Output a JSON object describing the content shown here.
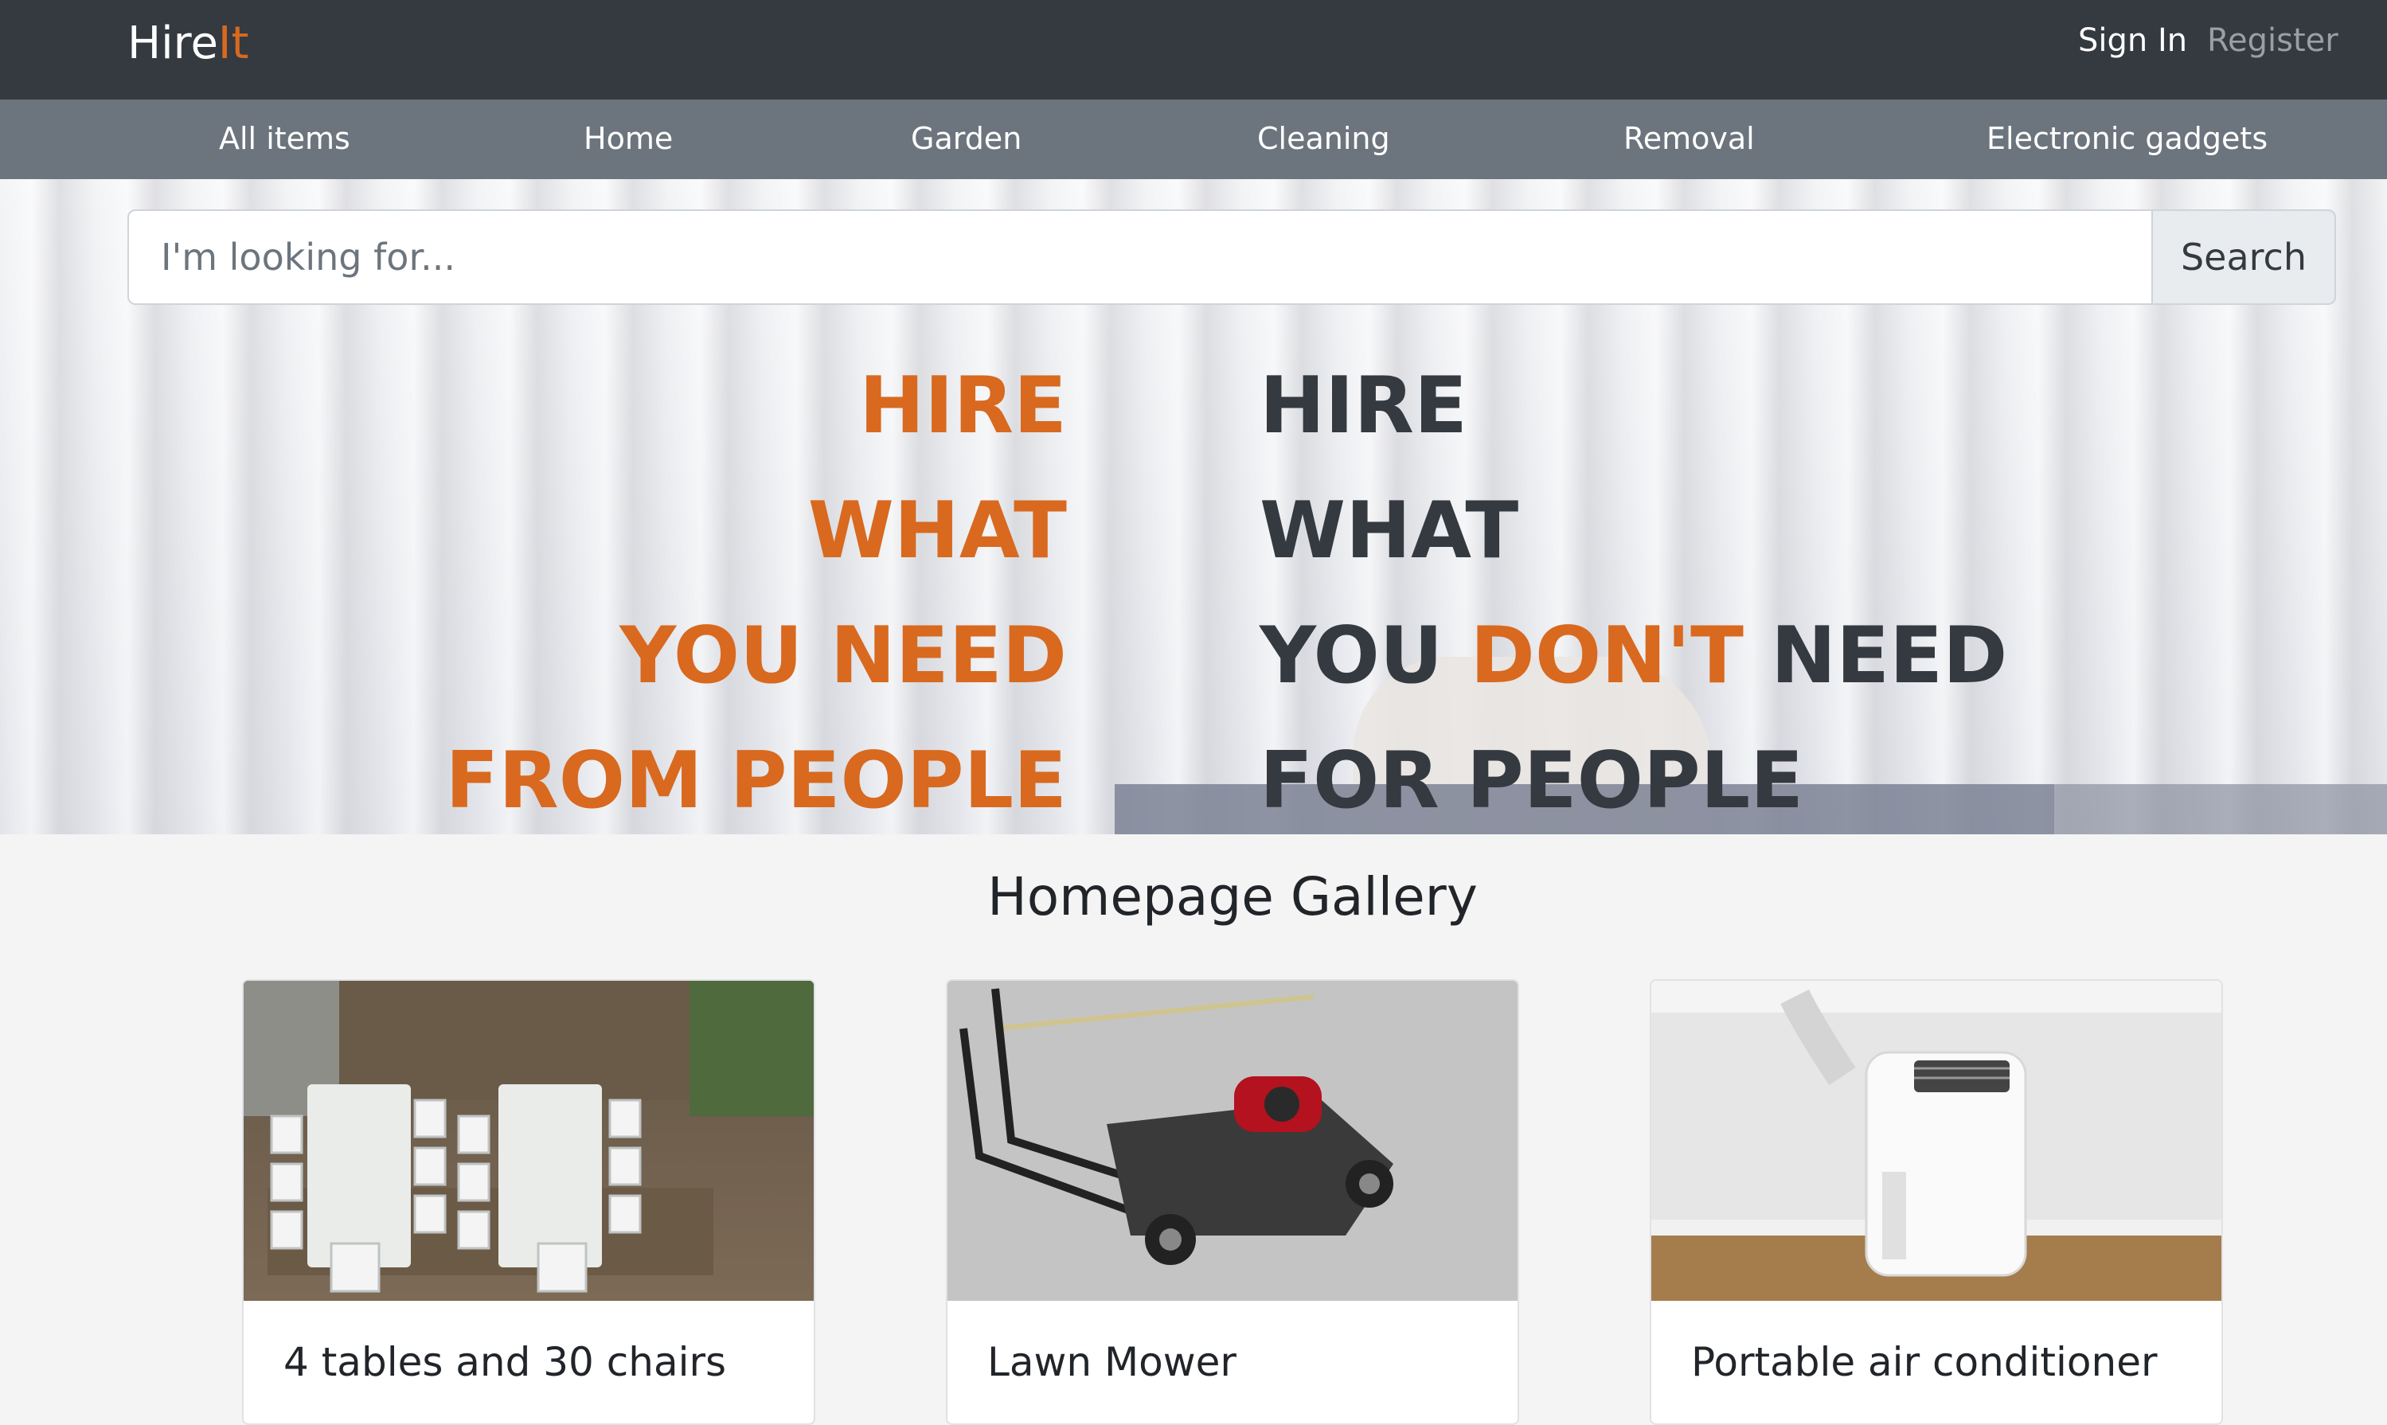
{
  "navbar": {
    "brand_part1": "Hire",
    "brand_part2": "It",
    "sign_in": "Sign In",
    "register": "Register"
  },
  "categories": [
    "All items",
    "Home",
    "Garden",
    "Cleaning",
    "Removal",
    "Electronic gadgets"
  ],
  "search": {
    "placeholder": "I'm looking for...",
    "button": "Search"
  },
  "hero": {
    "left_lines": [
      "HIRE",
      "WHAT",
      "YOU NEED",
      "FROM PEOPLE"
    ],
    "right_lines": {
      "line1": "HIRE",
      "line2": "WHAT",
      "line3_a": "YOU ",
      "line3_b": "DON'T",
      "line3_c": " NEED",
      "line4": "FOR PEOPLE"
    }
  },
  "gallery": {
    "title": "Homepage Gallery",
    "items": [
      {
        "title": "4 tables and 30 chairs",
        "image": "tables-and-chairs-photo"
      },
      {
        "title": "Lawn Mower",
        "image": "lawn-mower-photo"
      },
      {
        "title": "Portable air conditioner",
        "image": "air-conditioner-photo"
      }
    ]
  },
  "colors": {
    "accent": "#d8691f",
    "navbar": "#343a40",
    "category_bar": "#6c757d"
  }
}
